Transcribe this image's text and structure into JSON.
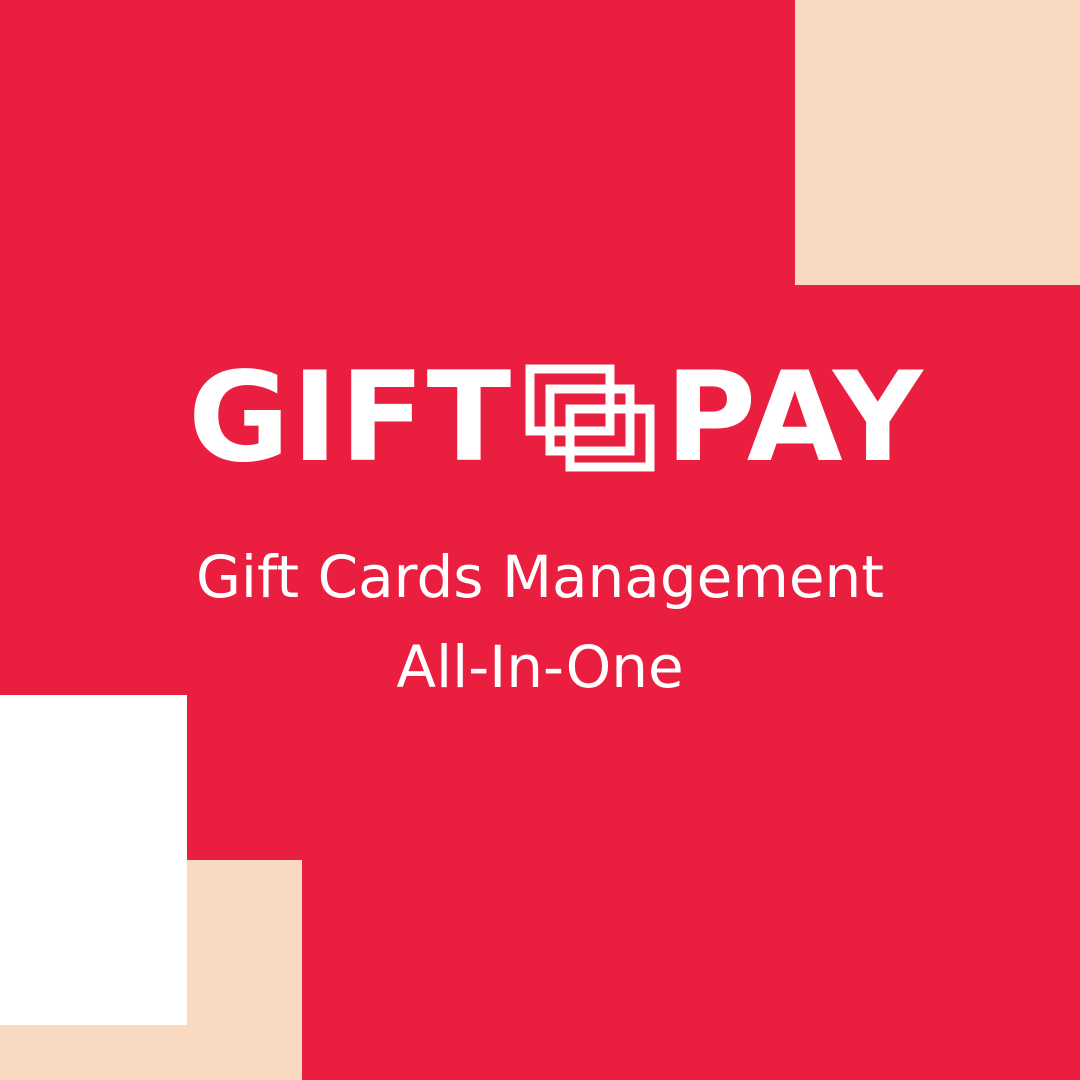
{
  "colors": {
    "background": "#EA1E3F",
    "peach": "#FAD9C1",
    "white": "#FFFFFF",
    "text": "#FFFFFF"
  },
  "logo": {
    "word_left": "GIFT",
    "word_right": "PAY",
    "mark_icon": "gift-card-stack-icon"
  },
  "tagline": {
    "line1": "Gift Cards Management",
    "line2": "All-In-One"
  }
}
